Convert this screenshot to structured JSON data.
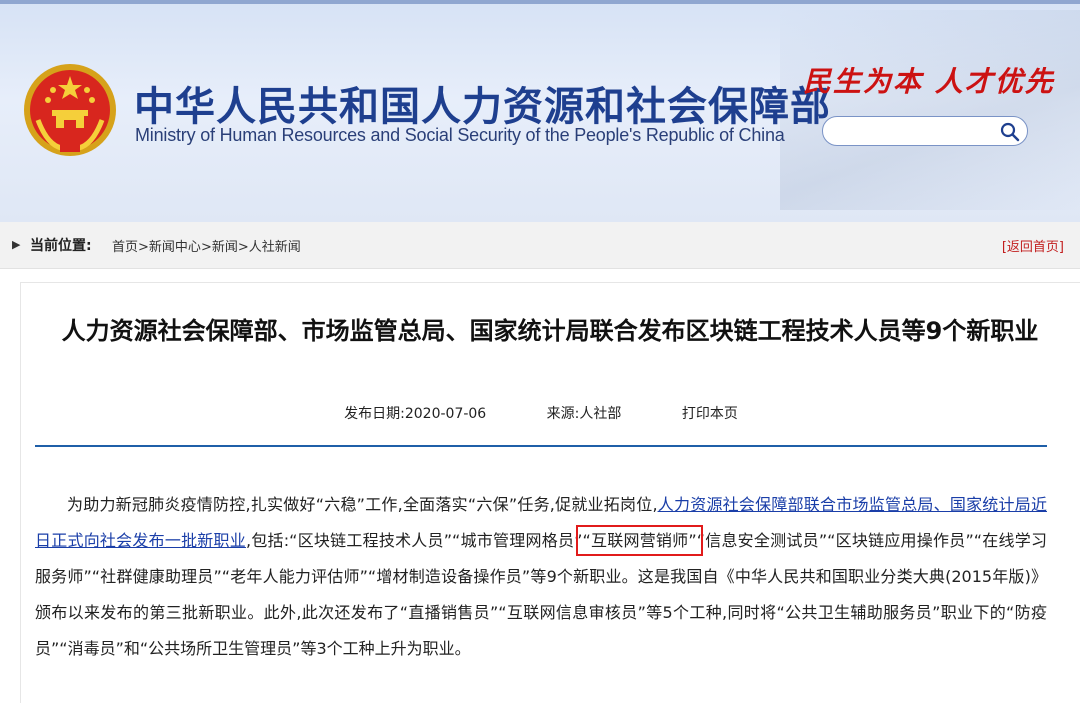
{
  "header": {
    "cn_title": "中华人民共和国人力资源和社会保障部",
    "en_title": "Ministry of Human Resources and Social Security of the People's Republic of China",
    "slogan": "民生为本 人才优先",
    "search": {
      "placeholder": "",
      "value": "",
      "icon": "search-icon"
    },
    "emblem_icon": "national-emblem-icon",
    "colors": {
      "title": "#1e3f8f",
      "slogan": "#cc1212"
    }
  },
  "breadcrumb": {
    "label": "当前位置:",
    "items": [
      "首页",
      "新闻中心",
      "新闻",
      "人社新闻"
    ],
    "separator": ">",
    "home_link": "[返回首页]"
  },
  "article": {
    "title": "人力资源社会保障部、市场监管总局、国家统计局联合发布区块链工程技术人员等9个新职业",
    "meta": {
      "date": "发布日期:2020-07-06",
      "source": "来源:人社部",
      "print": "打印本页"
    },
    "body": {
      "intro": "为助力新冠肺炎疫情防控,扎实做好“六稳”工作,全面落实“六保”任务,促就业拓岗位,",
      "link": "人力资源社会保障部联合市场监管总局、国家统计局近日正式向社会发布一批新职业",
      "mid1": ",包括:“区块链工程技术人员”“城市管理网格员”",
      "highlight": "“互联网营销师”",
      "rest": "“信息安全测试员”“区块链应用操作员”“在线学习服务师”“社群健康助理员”“老年人能力评估师”“增材制造设备操作员”等9个新职业。这是我国自《中华人民共和国职业分类大典(2015年版)》颁布以来发布的第三批新职业。此外,此次还发布了“直播销售员”“互联网信息审核员”等5个工种,同时将“公共卫生辅助服务员”职业下的“防疫员”“消毒员”和“公共场所卫生管理员”等3个工种上升为职业。"
    }
  }
}
